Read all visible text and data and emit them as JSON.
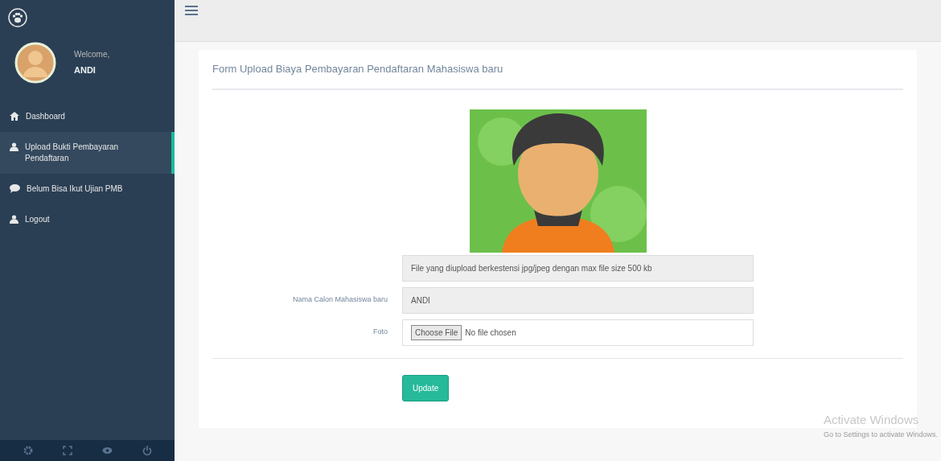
{
  "sidebar": {
    "welcome": "Welcome,",
    "user": "ANDI",
    "items": [
      {
        "label": "Dashboard",
        "kind": "home",
        "selected": false
      },
      {
        "label": "Upload Bukti Pembayaran Pendaftaran",
        "kind": "user",
        "selected": true
      },
      {
        "label": "Belum Bisa Ikut Ujian PMB",
        "kind": "chat",
        "selected": false
      },
      {
        "label": "Logout",
        "kind": "user",
        "selected": false
      }
    ]
  },
  "form": {
    "title": "Form Upload Biaya Pembayaran Pendaftaran Mahasiswa baru",
    "note": "File yang diupload berkestensi jpg/jpeg dengan max file size 500 kb",
    "fields": [
      {
        "label": "Nama Calon Mahasiswa baru",
        "kind": "text",
        "value": "ANDI"
      },
      {
        "label": "Foto",
        "kind": "file",
        "button": "Choose File",
        "value": "No file chosen"
      }
    ],
    "submit": "Update"
  },
  "activation": {
    "title": "Activate Windows",
    "subtitle": "Go to Settings to activate Windows."
  }
}
